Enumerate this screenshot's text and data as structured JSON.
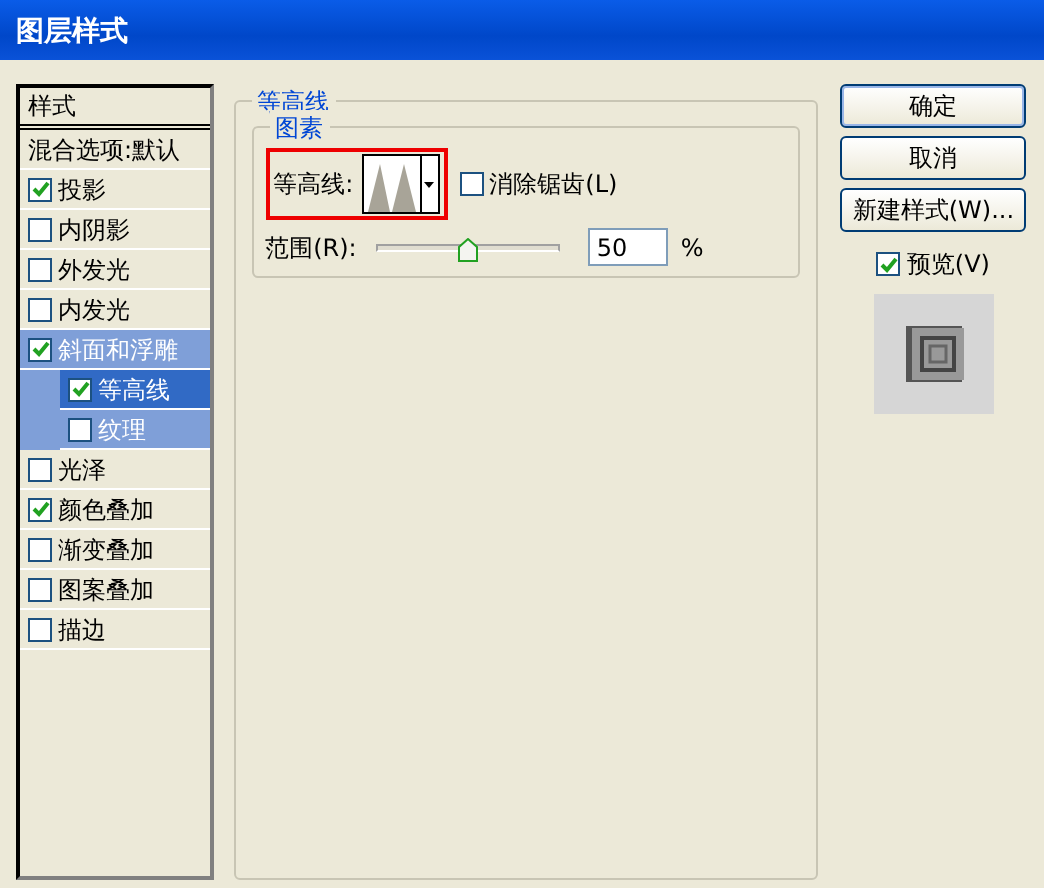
{
  "window": {
    "title": "图层样式"
  },
  "sidebar": {
    "header": "样式",
    "blend_options": "混合选项:默认",
    "items": [
      {
        "label": "投影",
        "checked": true,
        "selected": false
      },
      {
        "label": "内阴影",
        "checked": false,
        "selected": false
      },
      {
        "label": "外发光",
        "checked": false,
        "selected": false
      },
      {
        "label": "内发光",
        "checked": false,
        "selected": false
      },
      {
        "label": "斜面和浮雕",
        "checked": true,
        "selected": false,
        "children": [
          {
            "label": "等高线",
            "checked": true,
            "selected": true
          },
          {
            "label": "纹理",
            "checked": false,
            "selected": false
          }
        ]
      },
      {
        "label": "光泽",
        "checked": false,
        "selected": false
      },
      {
        "label": "颜色叠加",
        "checked": true,
        "selected": false
      },
      {
        "label": "渐变叠加",
        "checked": false,
        "selected": false
      },
      {
        "label": "图案叠加",
        "checked": false,
        "selected": false
      },
      {
        "label": "描边",
        "checked": false,
        "selected": false
      }
    ]
  },
  "panel": {
    "title": "等高线",
    "group": {
      "title": "图素",
      "contour_label": "等高线:",
      "anti_alias": {
        "label": "消除锯齿(L)",
        "checked": false
      },
      "range": {
        "label": "范围(R):",
        "level": 0.5,
        "value": "50",
        "unit": "%"
      }
    }
  },
  "buttons": [
    "确定",
    "取消",
    "新建样式(W)..."
  ],
  "preview": {
    "label": "预览(V)",
    "checked": true
  }
}
